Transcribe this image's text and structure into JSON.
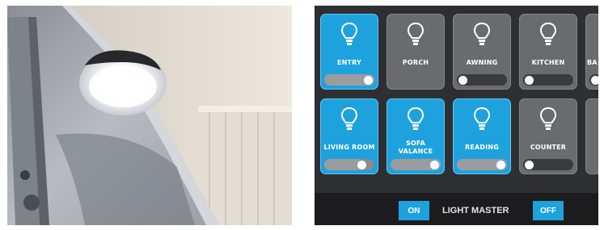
{
  "controls": {
    "tiles": [
      {
        "label": "ENTRY",
        "on": true,
        "level": 1.0
      },
      {
        "label": "PORCH",
        "on": false
      },
      {
        "label": "AWNING",
        "on": false,
        "level": 0.0
      },
      {
        "label": "KITCHEN",
        "on": false,
        "level": 0.0
      },
      {
        "label": "BA",
        "on": false,
        "level": 0.0
      },
      {
        "label": "LIVING ROOM",
        "on": true,
        "level": 0.75
      },
      {
        "label": "SOFA VALANCE",
        "on": true,
        "level": 1.0
      },
      {
        "label": "READING",
        "on": true,
        "level": 1.0
      },
      {
        "label": "COUNTER",
        "on": false,
        "level": 0.0
      },
      {
        "label": "",
        "on": false
      }
    ],
    "master": {
      "on_label": "ON",
      "title": "LIGHT MASTER",
      "off_label": "OFF"
    }
  },
  "colors": {
    "accent": "#1ea2de",
    "tile_off": "#6a6b6f",
    "panel": "#2e2f33"
  },
  "icons": {
    "tile_icon": "lightbulb-icon"
  }
}
